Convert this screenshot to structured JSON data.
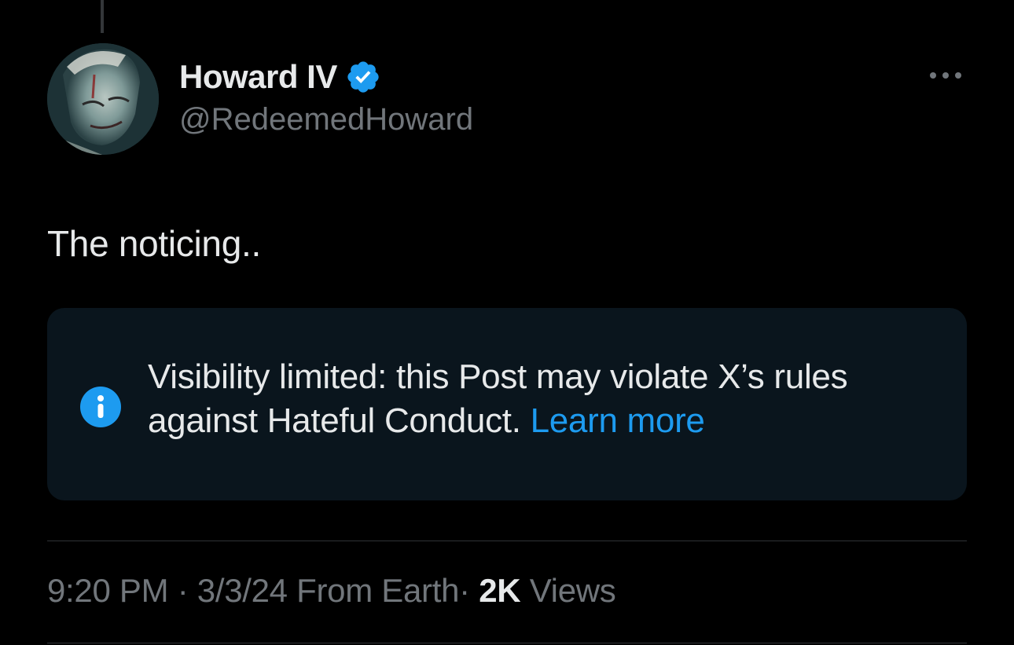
{
  "author": {
    "display_name": "Howard IV",
    "handle": "@RedeemedHoward",
    "verified": true
  },
  "post": {
    "text": "The noticing.."
  },
  "notice": {
    "text": "Visibility limited: this Post may violate X’s rules against Hateful Conduct.",
    "link_label": "Learn more"
  },
  "meta": {
    "time": "9:20 PM",
    "separator": "·",
    "date": "3/3/24",
    "source": "From Earth",
    "views_count": "2K",
    "views_label": "Views"
  },
  "icons": {
    "verified": "verified-badge-icon",
    "more": "more-options-icon",
    "info": "info-icon"
  },
  "colors": {
    "background": "#000000",
    "primary_text": "#e7e9ea",
    "secondary_text": "#71767b",
    "accent": "#1d9bf0",
    "notice_background": "#0a151d"
  }
}
